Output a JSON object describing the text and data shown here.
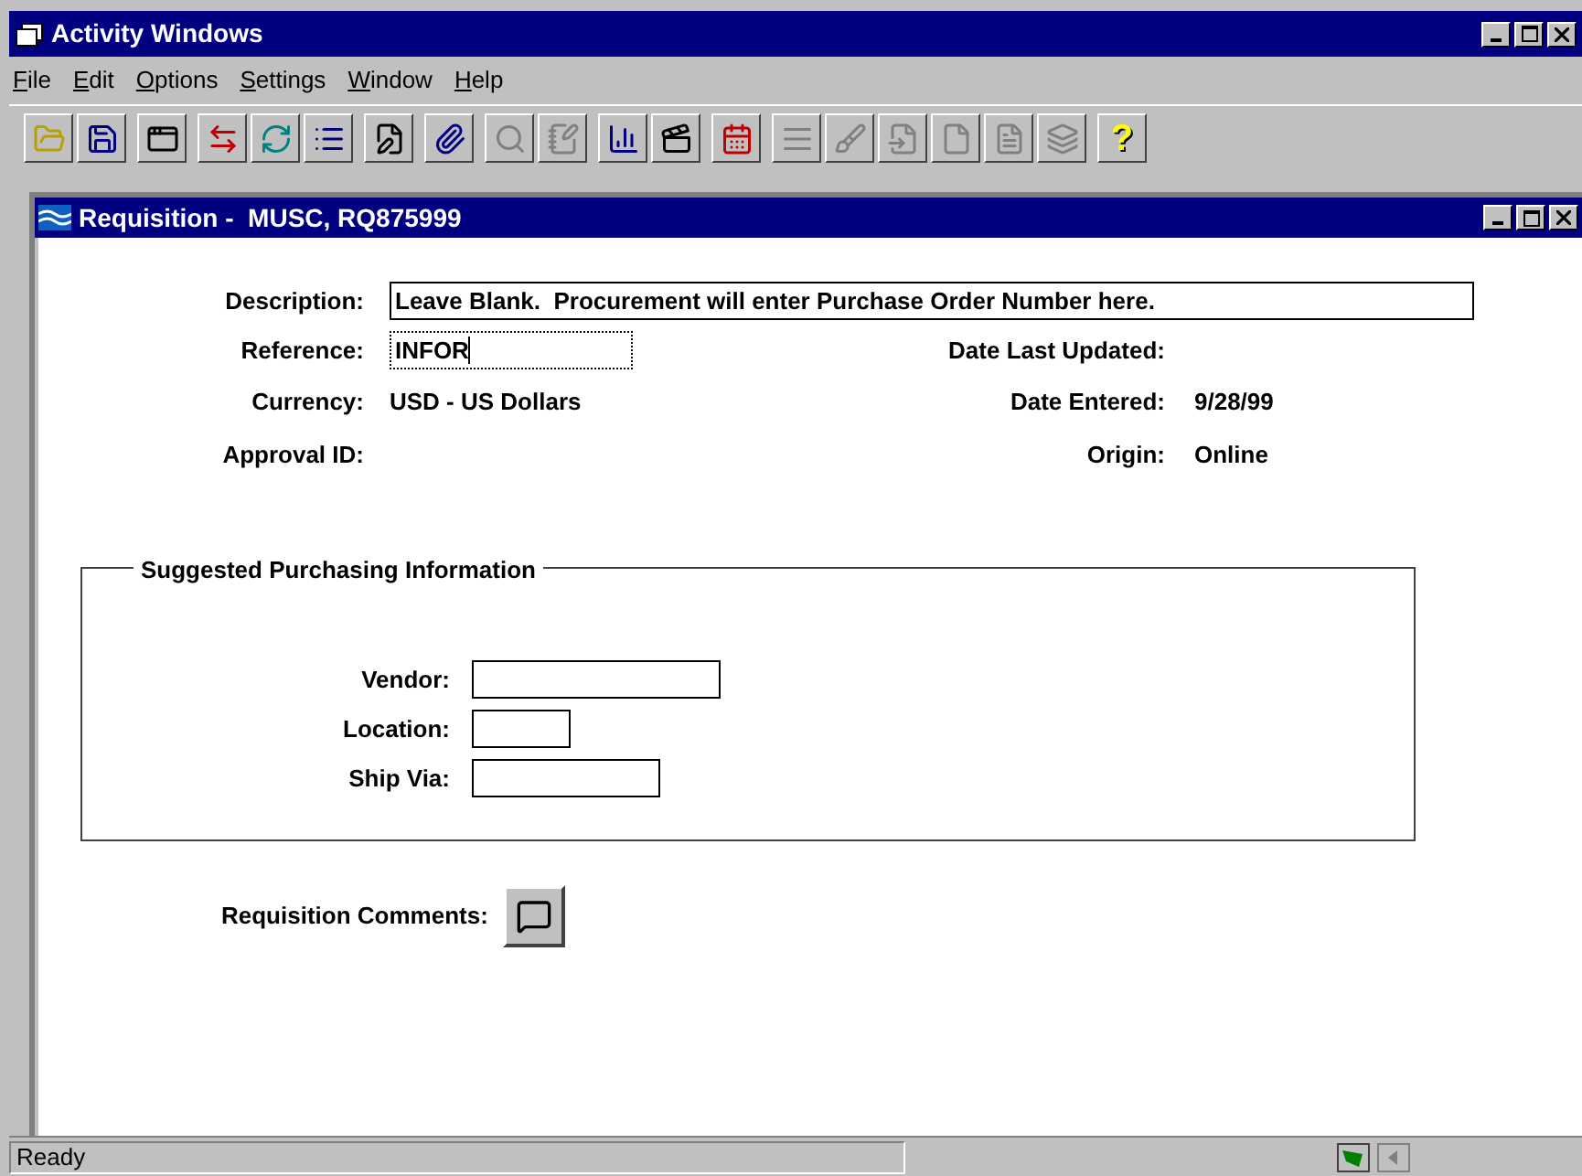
{
  "window": {
    "title": "Activity Windows"
  },
  "menu": [
    {
      "label": "File"
    },
    {
      "label": "Edit"
    },
    {
      "label": "Options"
    },
    {
      "label": "Settings"
    },
    {
      "label": "Window"
    },
    {
      "label": "Help"
    }
  ],
  "toolbar": [
    [
      {
        "kind": "open",
        "disabled": false
      },
      {
        "kind": "save",
        "disabled": false
      }
    ],
    [
      {
        "kind": "window",
        "disabled": false
      }
    ],
    [
      {
        "kind": "transfer",
        "disabled": false
      },
      {
        "kind": "refresh",
        "disabled": false
      },
      {
        "kind": "list",
        "disabled": false
      }
    ],
    [
      {
        "kind": "edit",
        "disabled": false
      }
    ],
    [
      {
        "kind": "attach",
        "disabled": false
      }
    ],
    [
      {
        "kind": "search",
        "disabled": true
      },
      {
        "kind": "note",
        "disabled": true
      }
    ],
    [
      {
        "kind": "chart",
        "disabled": false
      },
      {
        "kind": "clapper",
        "disabled": false
      }
    ],
    [
      {
        "kind": "calendar",
        "disabled": false
      }
    ],
    [
      {
        "kind": "lines",
        "disabled": true
      },
      {
        "kind": "broom",
        "disabled": true
      },
      {
        "kind": "page",
        "disabled": true
      },
      {
        "kind": "blank",
        "disabled": true
      },
      {
        "kind": "document",
        "disabled": true
      },
      {
        "kind": "stack",
        "disabled": true
      }
    ],
    [
      {
        "kind": "help",
        "label": "?",
        "disabled": false
      }
    ]
  ],
  "child_window": {
    "title": "Requisition -  MUSC, RQ875999",
    "description": {
      "label": "Description:",
      "value": "Leave Blank.  Procurement will enter Purchase Order Number here."
    },
    "reference": {
      "label": "Reference:",
      "value": "INFOR",
      "focused": true
    },
    "currency": {
      "label": "Currency:",
      "value": "USD - US Dollars"
    },
    "approval_id": {
      "label": "Approval ID:"
    },
    "date_last_updated": {
      "label": "Date Last Updated:"
    },
    "date_entered": {
      "label": "Date Entered:",
      "value": "9/28/99"
    },
    "origin": {
      "label": "Origin:",
      "value": "Online"
    },
    "group": {
      "title": "Suggested Purchasing Information",
      "fields": [
        {
          "label": "Vendor:"
        },
        {
          "label": "Location:"
        },
        {
          "label": "Ship Via:"
        }
      ]
    },
    "comments": {
      "label": "Requisition Comments:"
    }
  },
  "status_bar": {
    "text": "Ready"
  }
}
